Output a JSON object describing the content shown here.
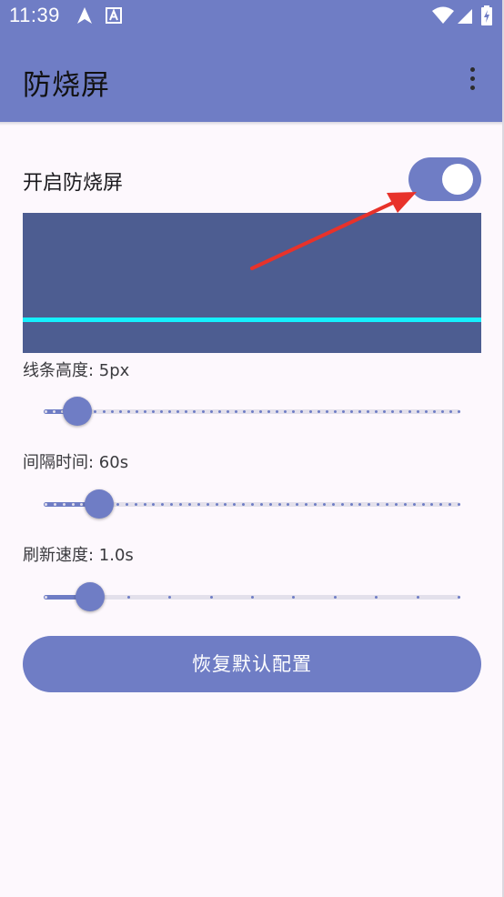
{
  "status_bar": {
    "time": "11:39",
    "icons": [
      "navigation-arrow-icon",
      "font-a-icon",
      "wifi-icon",
      "signal-icon",
      "battery-charging-icon"
    ]
  },
  "app_bar": {
    "title": "防烧屏",
    "menu_icon": "more-vert-icon"
  },
  "toggle": {
    "label": "开启防烧屏",
    "on": true
  },
  "preview": {
    "background_color": "#4d5d91",
    "line_color": "#15f0ff"
  },
  "sliders": [
    {
      "label": "线条高度: 5px",
      "min": 1,
      "max": 50,
      "value": 5,
      "ticks": 50
    },
    {
      "label": "间隔时间: 60s",
      "min": 0,
      "max": 450,
      "value": 60,
      "ticks": 46
    },
    {
      "label": "刷新速度: 1.0s",
      "min": 0,
      "max": 4.5,
      "value": 0.5,
      "ticks": 10
    }
  ],
  "reset_button": {
    "label": "恢复默认配置"
  },
  "colors": {
    "primary": "#6f7dc5",
    "track_inactive": "#e3e0eb",
    "annotation_arrow": "#e8322a"
  }
}
